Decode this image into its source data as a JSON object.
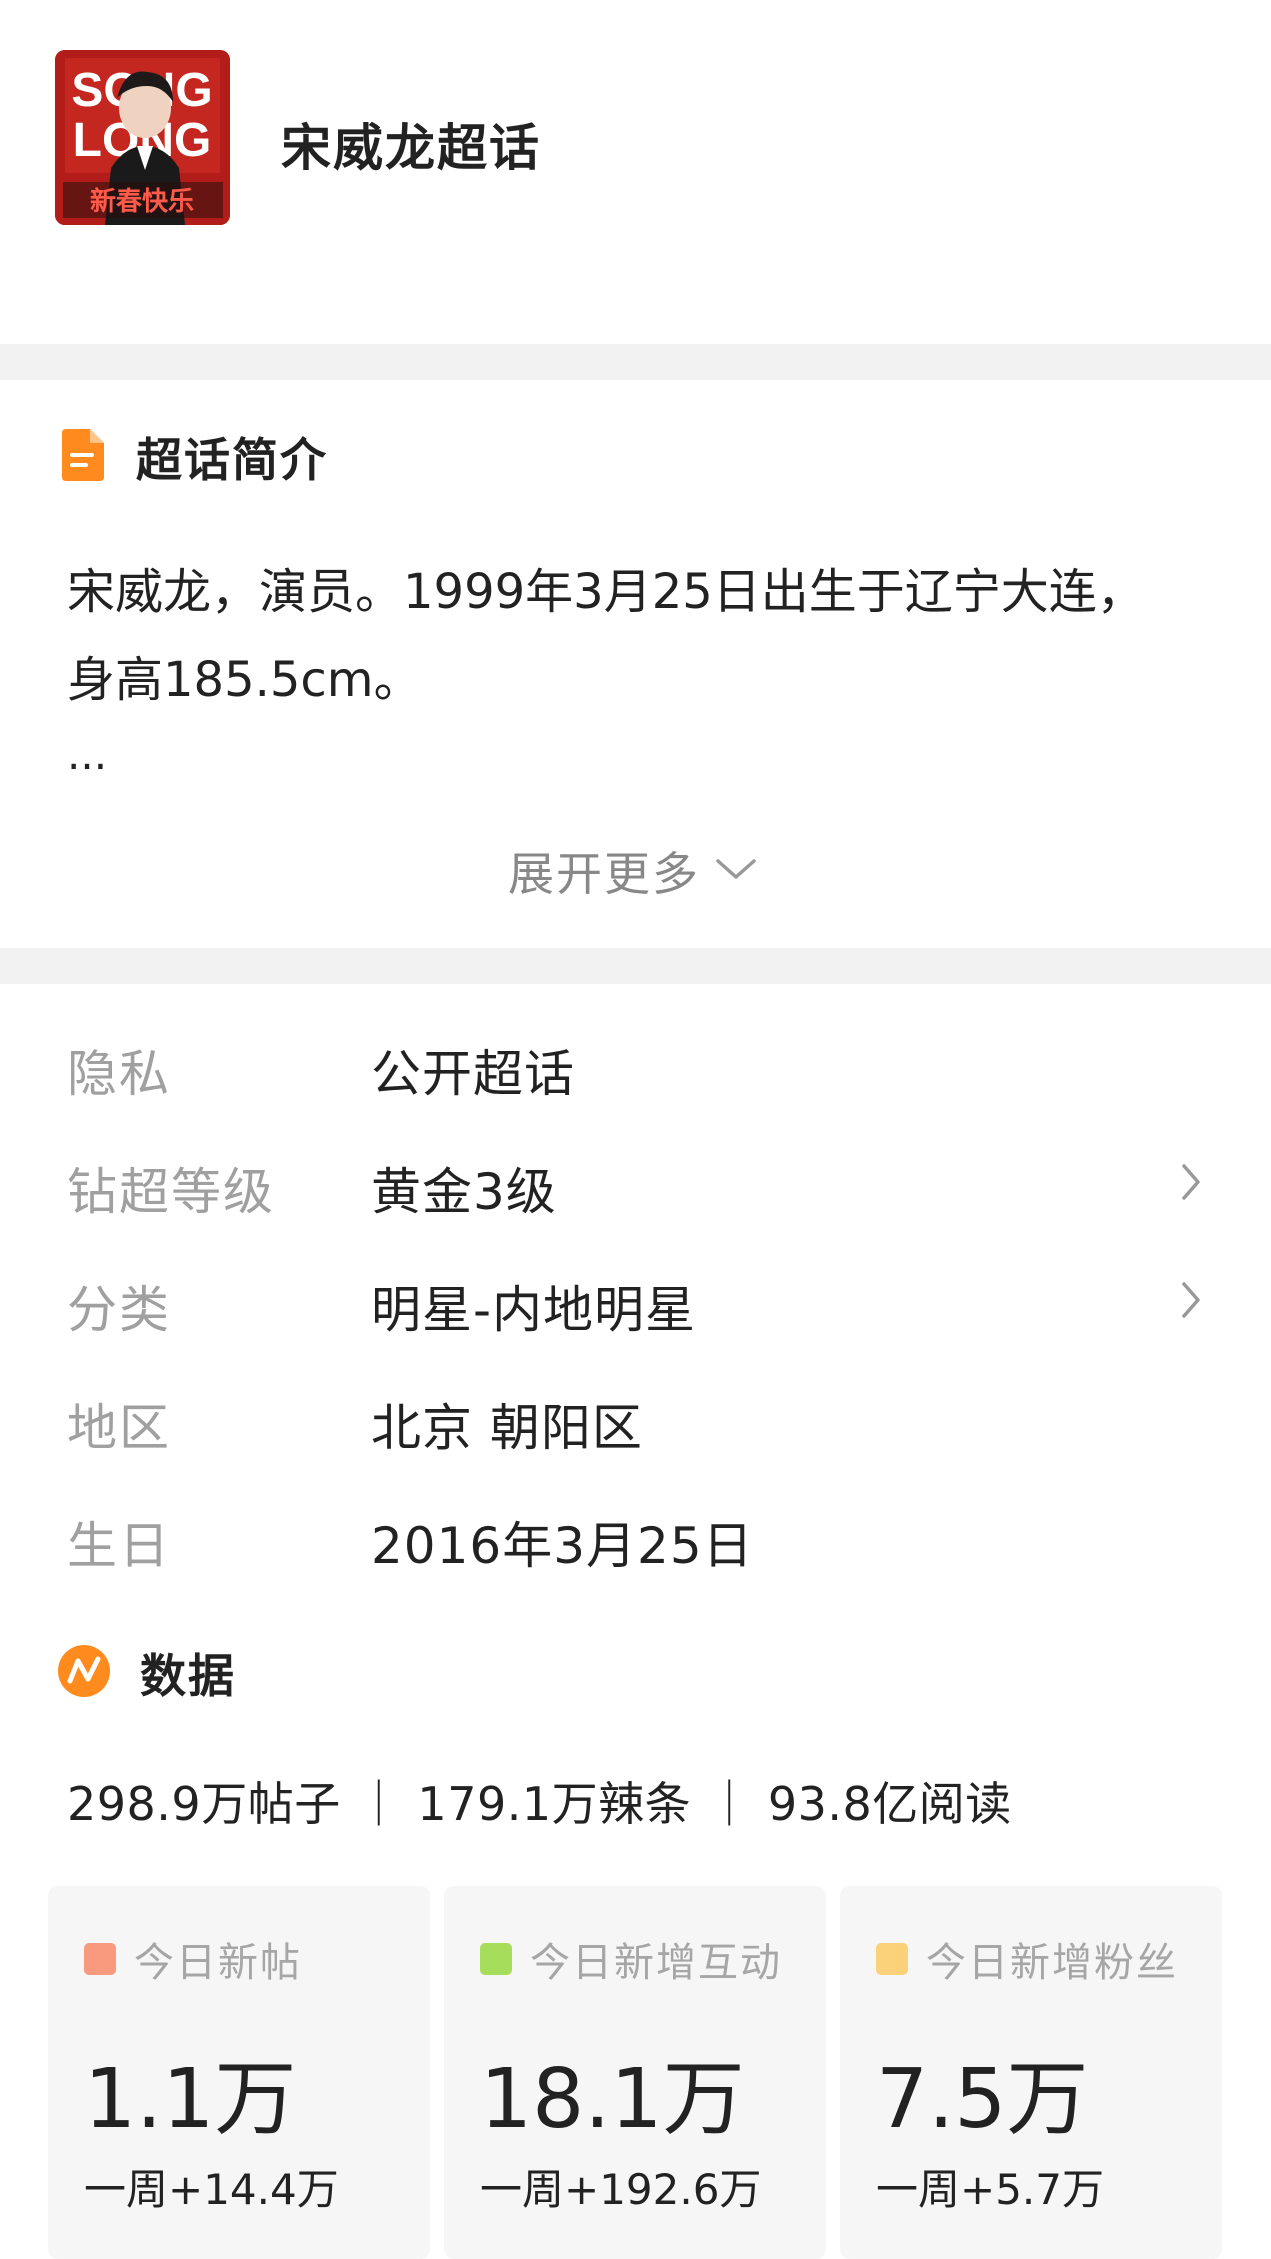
{
  "header": {
    "title": "宋威龙超话",
    "avatar": {
      "lettering_line1": "SONG",
      "lettering_line2": "LONG",
      "lettering_line3": "新春快乐",
      "bg_color": "#b21d19"
    }
  },
  "intro": {
    "section_title": "超话简介",
    "icon": "document-icon",
    "text": "宋威龙，演员。1999年3月25日出生于辽宁大连，身高185.5cm。",
    "ellipsis": "...",
    "expand_label": "展开更多"
  },
  "info": [
    {
      "key": "隐私",
      "value": "公开超话",
      "has_arrow": false
    },
    {
      "key": "钻超等级",
      "value": "黄金3级",
      "has_arrow": true
    },
    {
      "key": "分类",
      "value": "明星-内地明星",
      "has_arrow": true
    },
    {
      "key": "地区",
      "value": "北京 朝阳区",
      "has_arrow": false
    },
    {
      "key": "生日",
      "value": "2016年3月25日",
      "has_arrow": false
    }
  ],
  "data_section": {
    "title": "数据",
    "icon": "trend-icon",
    "summary": "298.9万帖子 ｜ 179.1万辣条 ｜ 93.8亿阅读"
  },
  "cards": [
    {
      "label": "今日新帖",
      "value": "1.1万",
      "weekly": "一周+14.4万",
      "color": "#f79a7e"
    },
    {
      "label": "今日新增互动",
      "value": "18.1万",
      "weekly": "一周+192.6万",
      "color": "#a6de5b"
    },
    {
      "label": "今日新增粉丝",
      "value": "7.5万",
      "weekly": "一周+5.7万",
      "color": "#fbd27a"
    }
  ],
  "colors": {
    "accent_orange": "#ff8a1e",
    "divider": "#f2f2f2",
    "label_gray": "#a0a0a0"
  }
}
